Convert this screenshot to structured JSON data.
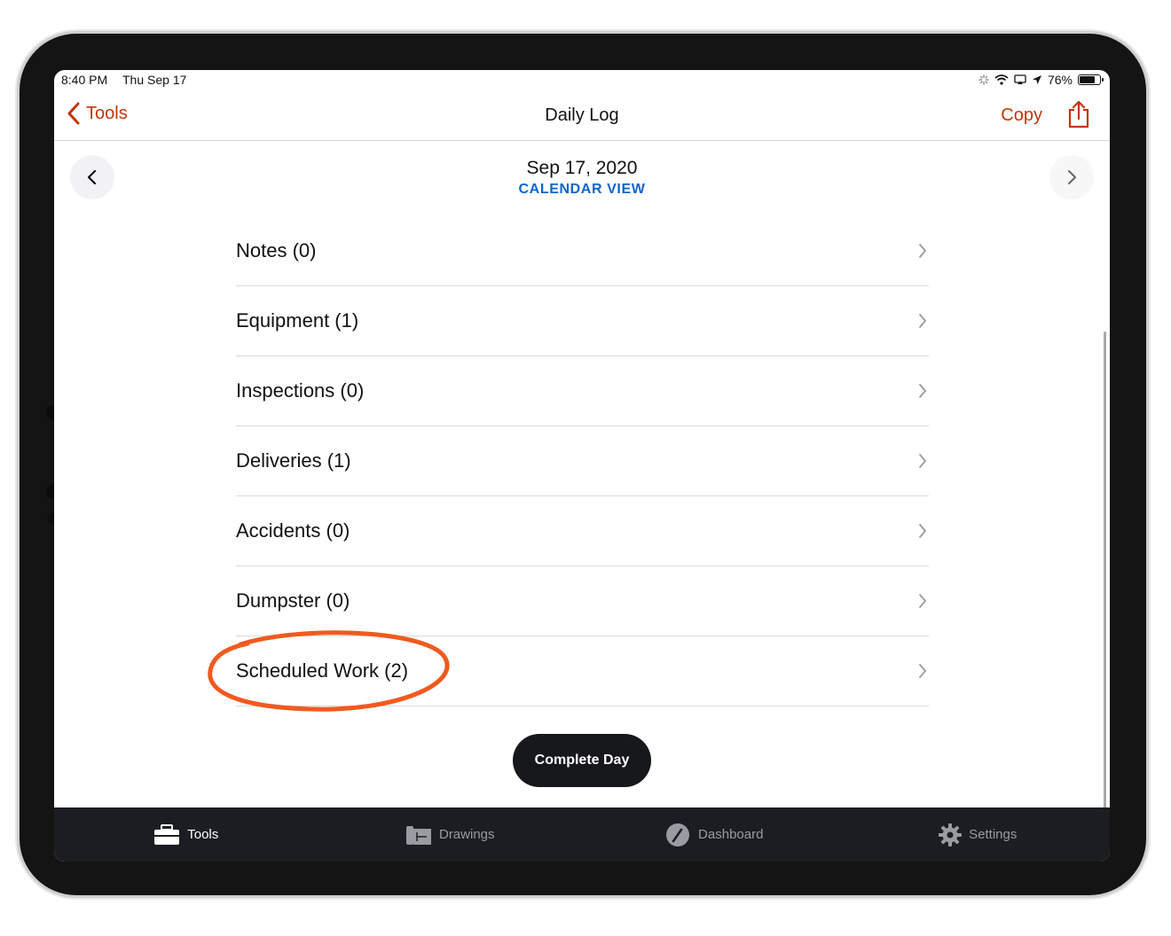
{
  "status": {
    "time": "8:40 PM",
    "date": "Thu Sep 17",
    "battery": "76%",
    "battery_level": 0.76
  },
  "nav": {
    "back_label": "Tools",
    "title": "Daily Log",
    "copy_label": "Copy"
  },
  "date_header": {
    "date": "Sep 17, 2020",
    "calendar_view": "CALENDAR VIEW"
  },
  "log_items": [
    {
      "label": "Notes (0)"
    },
    {
      "label": "Equipment (1)"
    },
    {
      "label": "Inspections (0)"
    },
    {
      "label": "Deliveries (1)"
    },
    {
      "label": "Accidents (0)"
    },
    {
      "label": "Dumpster (0)"
    },
    {
      "label": "Scheduled Work (2)"
    }
  ],
  "complete_day_label": "Complete Day",
  "tabs": [
    {
      "label": "Tools",
      "icon": "toolbox-icon",
      "active": true
    },
    {
      "label": "Drawings",
      "icon": "drawings-icon",
      "active": false
    },
    {
      "label": "Dashboard",
      "icon": "dashboard-icon",
      "active": false
    },
    {
      "label": "Settings",
      "icon": "gear-icon",
      "active": false
    }
  ],
  "colors": {
    "accent": "#c1360a",
    "link": "#0a66c9",
    "highlight": "#f05a1e",
    "tabbar": "#1c1d22"
  }
}
